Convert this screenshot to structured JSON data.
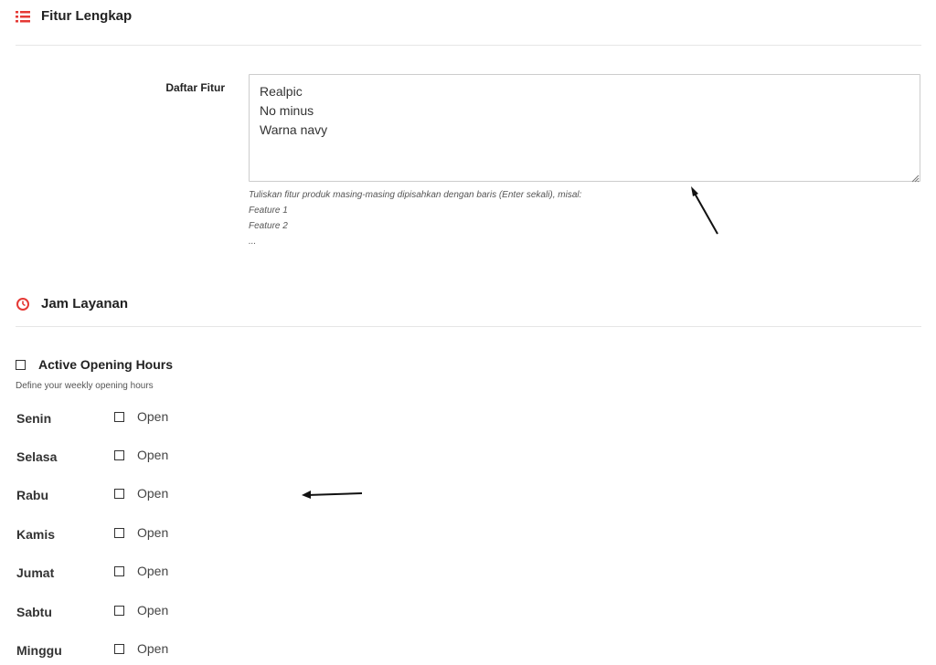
{
  "features_section": {
    "title": "Fitur Lengkap",
    "icon": "list-icon",
    "accent_color": "#e53935",
    "field_label": "Daftar Fitur",
    "textarea_value": "Realpic\nNo minus\nWarna navy",
    "help_lines": [
      "Tuliskan fitur produk masing-masing dipisahkan dengan baris (Enter sekali), misal:",
      "Feature 1",
      "Feature 2",
      "..."
    ]
  },
  "hours_section": {
    "title": "Jam Layanan",
    "icon": "clock-icon",
    "accent_color": "#e53935",
    "active_label": "Active Opening Hours",
    "active_checked": false,
    "define_text": "Define your weekly opening hours",
    "days": [
      {
        "name": "Senin",
        "open_label": "Open",
        "checked": false
      },
      {
        "name": "Selasa",
        "open_label": "Open",
        "checked": false
      },
      {
        "name": "Rabu",
        "open_label": "Open",
        "checked": false
      },
      {
        "name": "Kamis",
        "open_label": "Open",
        "checked": false
      },
      {
        "name": "Jumat",
        "open_label": "Open",
        "checked": false
      },
      {
        "name": "Sabtu",
        "open_label": "Open",
        "checked": false
      },
      {
        "name": "Minggu",
        "open_label": "Open",
        "checked": false
      }
    ]
  }
}
